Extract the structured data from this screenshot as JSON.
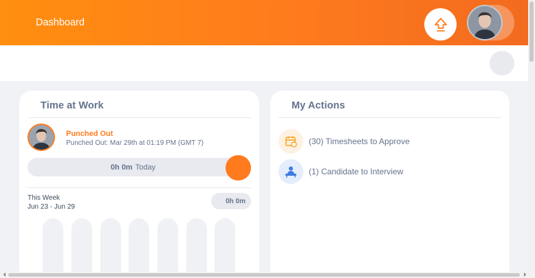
{
  "header": {
    "title": "Dashboard",
    "upgrade_icon": "upload-arrow-icon"
  },
  "time_at_work": {
    "title": "Time at Work",
    "status": "Punched Out",
    "status_detail": "Punched Out: Mar 29th at 01:19 PM (GMT 7)",
    "today_value": "0h 0m",
    "today_label": "Today",
    "week_label": "This Week",
    "week_range": "Jun 23 - Jun 29",
    "week_total": "0h 0m",
    "accent_color": "#ff7b1d"
  },
  "my_actions": {
    "title": "My Actions",
    "items": [
      {
        "label": "(30) Timesheets to Approve",
        "icon": "timesheet-calendar-icon",
        "color": "#f5a623"
      },
      {
        "label": "(1) Candidate to Interview",
        "icon": "candidate-interview-icon",
        "color": "#3f7be0"
      }
    ]
  }
}
